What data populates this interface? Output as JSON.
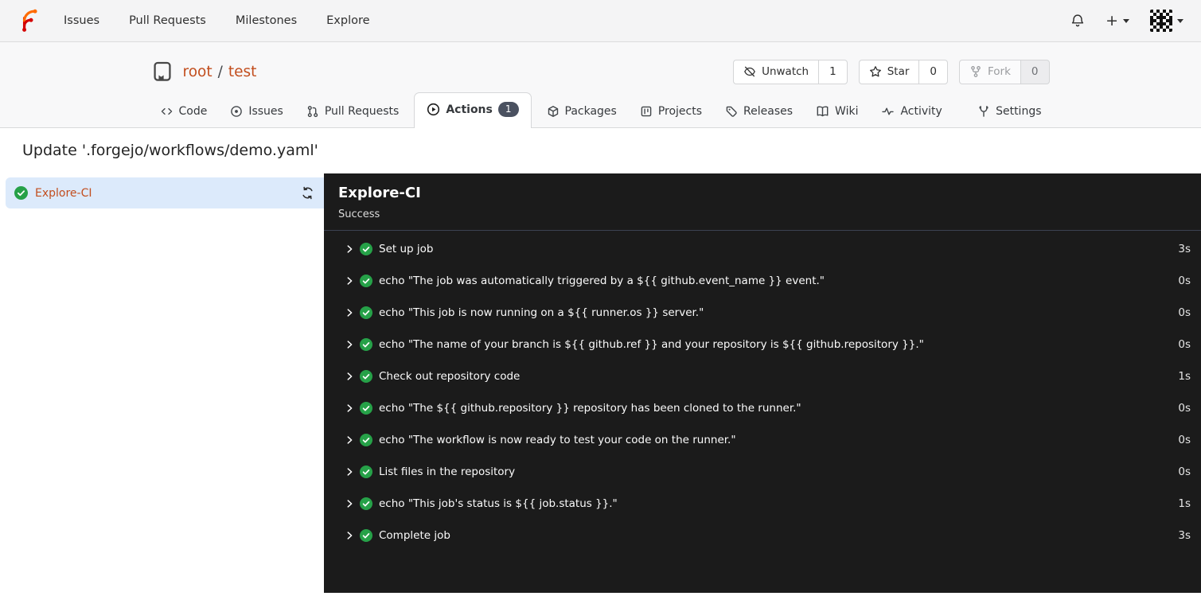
{
  "navbar": {
    "links": [
      {
        "label": "Issues"
      },
      {
        "label": "Pull Requests"
      },
      {
        "label": "Milestones"
      },
      {
        "label": "Explore"
      }
    ],
    "plus_label": "+"
  },
  "repo": {
    "owner": "root",
    "separator": "/",
    "name": "test",
    "actions": [
      {
        "label": "Unwatch",
        "count": "1"
      },
      {
        "label": "Star",
        "count": "0"
      },
      {
        "label": "Fork",
        "count": "0"
      }
    ],
    "tabs": [
      {
        "label": "Code"
      },
      {
        "label": "Issues"
      },
      {
        "label": "Pull Requests"
      },
      {
        "label": "Actions",
        "badge": "1"
      },
      {
        "label": "Packages"
      },
      {
        "label": "Projects"
      },
      {
        "label": "Releases"
      },
      {
        "label": "Wiki"
      },
      {
        "label": "Activity"
      },
      {
        "label": "Settings"
      }
    ]
  },
  "run": {
    "title": "Update '.forgejo/workflows/demo.yaml'",
    "job": {
      "name": "Explore-CI"
    },
    "panel": {
      "title": "Explore-CI",
      "status": "Success"
    },
    "steps": [
      {
        "name": "Set up job",
        "duration": "3s"
      },
      {
        "name": "echo \"The job was automatically triggered by a ${{ github.event_name }} event.\"",
        "duration": "0s"
      },
      {
        "name": "echo \"This job is now running on a ${{ runner.os }} server.\"",
        "duration": "0s"
      },
      {
        "name": "echo \"The name of your branch is ${{ github.ref }} and your repository is ${{ github.repository }}.\"",
        "duration": "0s"
      },
      {
        "name": "Check out repository code",
        "duration": "1s"
      },
      {
        "name": "echo \"The ${{ github.repository }} repository has been cloned to the runner.\"",
        "duration": "0s"
      },
      {
        "name": "echo \"The workflow is now ready to test your code on the runner.\"",
        "duration": "0s"
      },
      {
        "name": "List files in the repository",
        "duration": "0s"
      },
      {
        "name": "echo \"This job's status is ${{ job.status }}.\"",
        "duration": "1s"
      },
      {
        "name": "Complete job",
        "duration": "3s"
      }
    ]
  },
  "colors": {
    "accent_link": "#c24e1e",
    "success_green": "#26a148",
    "panel_bg": "#1b1b1b",
    "selected_job_bg": "#dceafb",
    "badge_bg": "#4a5160"
  }
}
